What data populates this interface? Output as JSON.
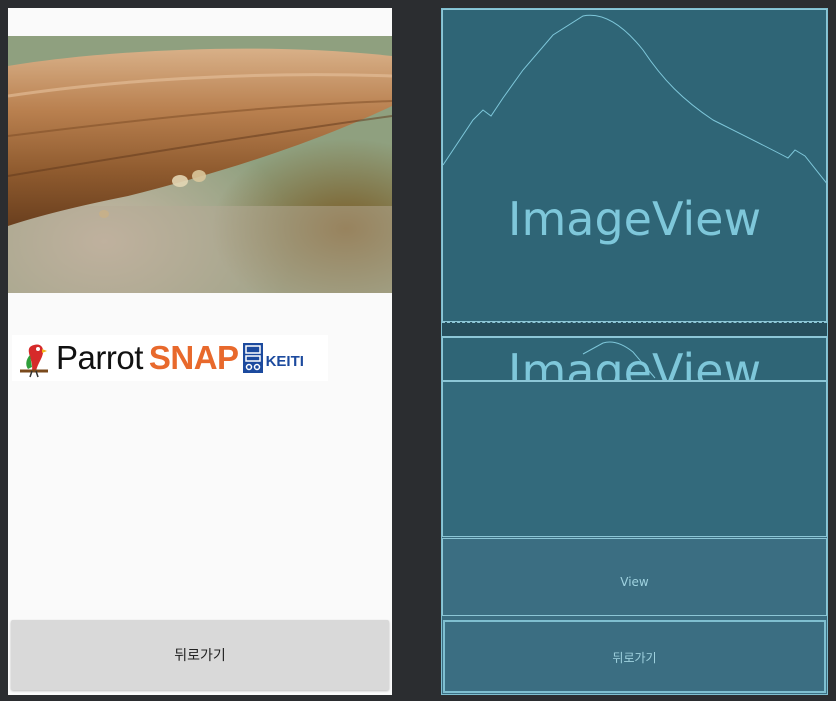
{
  "preview": {
    "back_button_label": "뒤로가기",
    "logo": {
      "parrot_text": "Parrot",
      "snap_text": "SNAP",
      "seal_text": "",
      "keiti_text": "KEITI"
    }
  },
  "blueprint": {
    "imageview_main_label": "ImageView",
    "imageview_small_label": "ImageView",
    "view_label": "View",
    "button_label": "뒤로가기"
  },
  "colors": {
    "preview_background": "#fafafa",
    "button_background": "#d9d9d9",
    "snap_orange": "#e8692c",
    "keiti_blue": "#1c4a9e",
    "blueprint_background": "#3b6e82",
    "blueprint_text": "#7ec7da"
  }
}
